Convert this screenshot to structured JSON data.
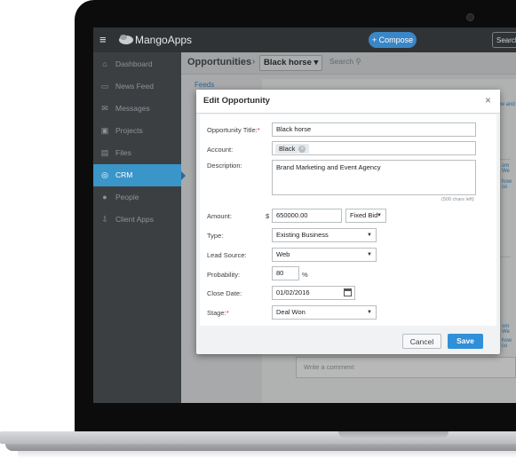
{
  "app": {
    "brand": "MangoApps",
    "compose_label": "Compose",
    "top_search_label": "Search"
  },
  "sidebar": {
    "items": [
      {
        "label": "Dashboard",
        "icon": "home-icon"
      },
      {
        "label": "News Feed",
        "icon": "inbox-icon"
      },
      {
        "label": "Messages",
        "icon": "envelope-icon"
      },
      {
        "label": "Projects",
        "icon": "briefcase-icon"
      },
      {
        "label": "Files",
        "icon": "files-icon"
      },
      {
        "label": "CRM",
        "icon": "crm-icon",
        "active": true
      },
      {
        "label": "People",
        "icon": "person-icon"
      },
      {
        "label": "Client Apps",
        "icon": "download-icon"
      }
    ]
  },
  "header": {
    "breadcrumb": "Opportunities",
    "separator": "›",
    "selected": "Black horse",
    "search_placeholder": "Search"
  },
  "background": {
    "feeds_label": "Feeds",
    "comment_placeholder": "Write a comment",
    "snippets": [
      "new and",
      "om We",
      "how co",
      "om We",
      "how co"
    ]
  },
  "modal": {
    "title": "Edit Opportunity",
    "fields": {
      "title": {
        "label": "Opportunity Title:",
        "value": "Black horse"
      },
      "account": {
        "label": "Account:",
        "value": "Black"
      },
      "description": {
        "label": "Description:",
        "value": "Brand Marketing and Event Agency",
        "hint": "(500 chars left)"
      },
      "amount": {
        "label": "Amount:",
        "currency": "$",
        "value": "650000.00",
        "bid_type": "Fixed Bid"
      },
      "type": {
        "label": "Type:",
        "value": "Existing Business"
      },
      "lead_source": {
        "label": "Lead Source:",
        "value": "Web"
      },
      "probability": {
        "label": "Probability:",
        "value": "80",
        "unit": "%"
      },
      "close_date": {
        "label": "Close Date:",
        "value": "01/02/2016"
      },
      "stage": {
        "label": "Stage:",
        "value": "Deal Won"
      }
    },
    "cancel_label": "Cancel",
    "save_label": "Save"
  },
  "colors": {
    "sidebar_bg": "#3b3f42",
    "accent": "#3a95c9",
    "save": "#2f8fd8",
    "topbar": "#2f3336"
  }
}
